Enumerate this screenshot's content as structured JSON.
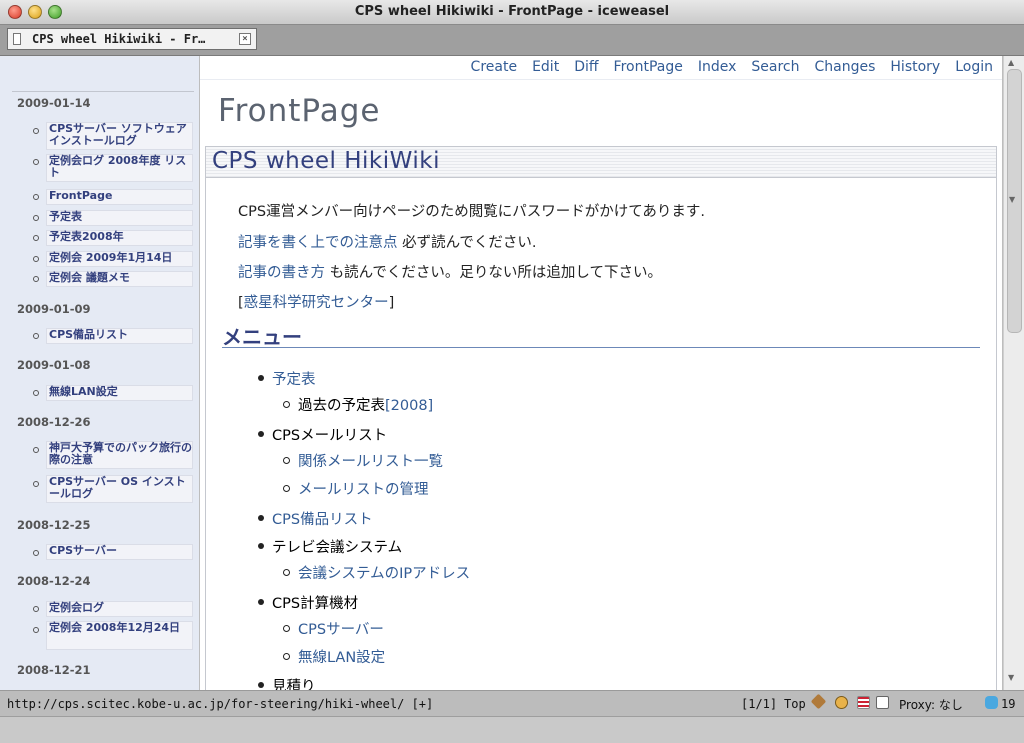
{
  "window": {
    "title": "CPS wheel Hikiwiki - FrontPage - iceweasel"
  },
  "tab": {
    "label": "CPS wheel Hikiwiki - Fr…",
    "close_glyph": "×"
  },
  "nav": [
    "Create",
    "Edit",
    "Diff",
    "FrontPage",
    "Index",
    "Search",
    "Changes",
    "History",
    "Login"
  ],
  "page_title": "FrontPage",
  "wiki_heading": "CPS wheel HikiWiki",
  "paras": {
    "p1": "CPS運営メンバー向けページのため閲覧にパスワードがかけてあります.",
    "p2_link": "記事を書く上での注意点",
    "p2_text": " 必ず読んでください.",
    "p3_link": "記事の書き方",
    "p3_text": " も読んでください。足りない所は追加して下さい。",
    "p4_open": "[",
    "p4_link": "惑星科学研究センター",
    "p4_close": "]"
  },
  "menu": {
    "heading": "メニュー",
    "items": {
      "yoteihyo": "予定表",
      "kako": "過去の予定表",
      "kako_link": "[2008]",
      "mail": "CPSメールリスト",
      "mail_list": "関係メールリスト一覧",
      "mail_admin": "メールリストの管理",
      "bihin": "CPS備品リスト",
      "tv": "テレビ会議システム",
      "tv_ip": "会議システムのIPアドレス",
      "keisan": "CPS計算機材",
      "server": "CPSサーバー",
      "lan": "無線LAN設定",
      "mitsumori": "見積り"
    }
  },
  "sidebar": {
    "dates": [
      "2009-01-14",
      "2009-01-09",
      "2009-01-08",
      "2008-12-26",
      "2008-12-25",
      "2008-12-24",
      "2008-12-21"
    ],
    "items": [
      "CPSサーバー ソフトウェア インストールログ",
      "定例会ログ 2008年度 リスト",
      "FrontPage",
      "予定表",
      "予定表2008年",
      "定例会 2009年1月14日",
      "定例会 議題メモ",
      "CPS備品リスト",
      "無線LAN設定",
      "神戸大予算でのパック旅行の際の注意",
      "CPSサーバー OS インストールログ",
      "CPSサーバー",
      "定例会ログ",
      "定例会 2008年12月24日"
    ]
  },
  "status": {
    "url": "http://cps.scitec.kobe-u.ac.jp/for-steering/hiki-wheel/ [+]",
    "page": "[1/1]",
    "scroll": "Top",
    "proxy": "Proxy: なし",
    "count": "19"
  }
}
